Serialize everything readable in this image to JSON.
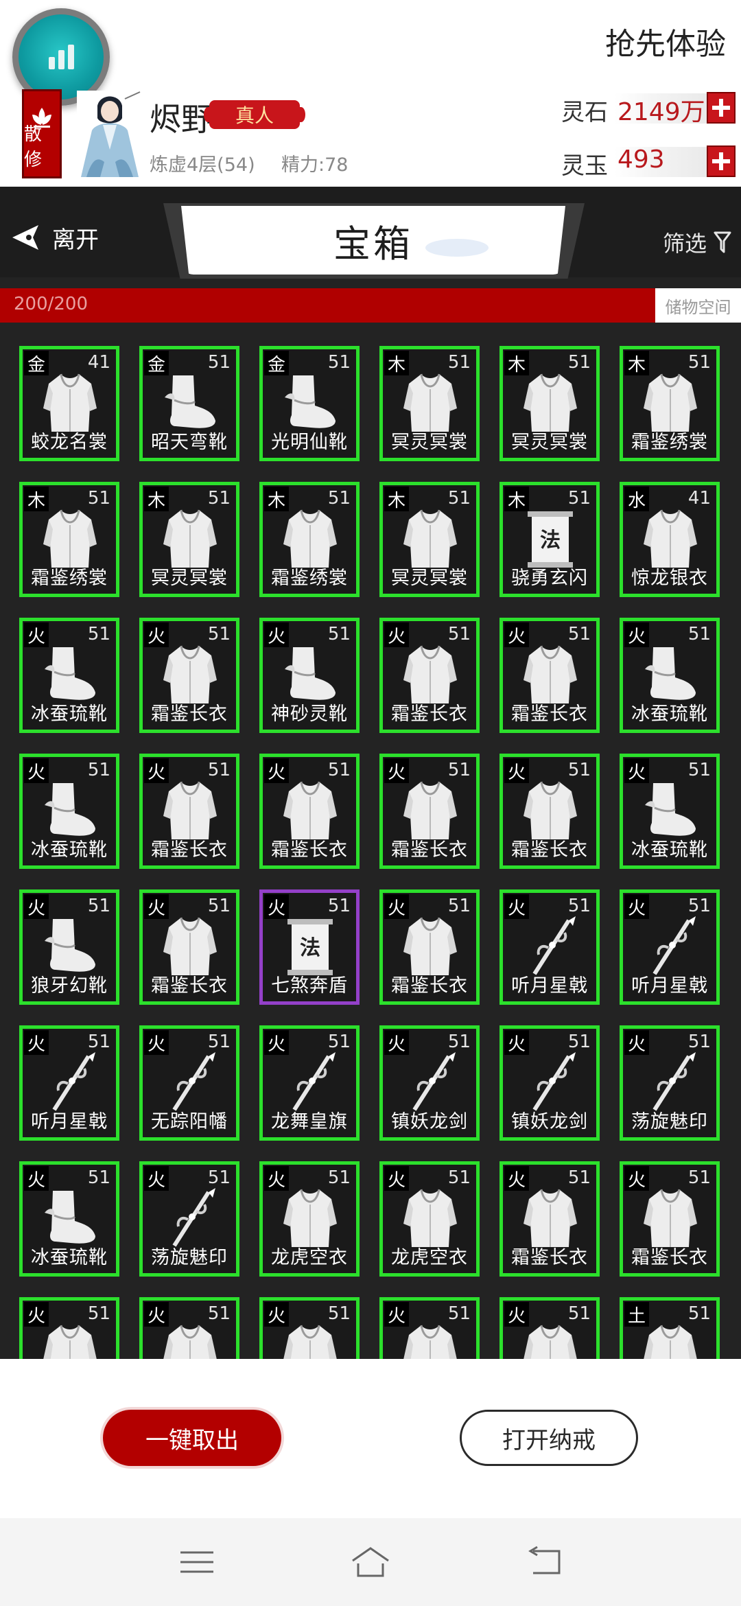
{
  "header": {
    "try_first": "抢先体验",
    "sect_badge": "散修",
    "player_name": "烬野",
    "title_badge": "真人",
    "realm": "炼虚4层(54)",
    "energy": "精力:78",
    "currencies": [
      {
        "label": "灵石",
        "value": "2149万"
      },
      {
        "label": "灵玉",
        "value": "493"
      }
    ]
  },
  "nav": {
    "leave": "离开",
    "title": "宝箱",
    "filter": "筛选"
  },
  "storage": {
    "capacity": "200/200",
    "tab": "储物空间"
  },
  "items": [
    {
      "el": "金",
      "lv": "41",
      "name": "蛟龙名裳",
      "icon": "robe",
      "rarity": "green"
    },
    {
      "el": "金",
      "lv": "51",
      "name": "昭天弯靴",
      "icon": "boot",
      "rarity": "green"
    },
    {
      "el": "金",
      "lv": "51",
      "name": "光明仙靴",
      "icon": "boot",
      "rarity": "green"
    },
    {
      "el": "木",
      "lv": "51",
      "name": "冥灵冥裳",
      "icon": "robe",
      "rarity": "green"
    },
    {
      "el": "木",
      "lv": "51",
      "name": "冥灵冥裳",
      "icon": "robe",
      "rarity": "green"
    },
    {
      "el": "木",
      "lv": "51",
      "name": "霜鉴绣裳",
      "icon": "robe",
      "rarity": "green"
    },
    {
      "el": "木",
      "lv": "51",
      "name": "霜鉴绣裳",
      "icon": "robe",
      "rarity": "green"
    },
    {
      "el": "木",
      "lv": "51",
      "name": "冥灵冥裳",
      "icon": "robe",
      "rarity": "green"
    },
    {
      "el": "木",
      "lv": "51",
      "name": "霜鉴绣裳",
      "icon": "robe",
      "rarity": "green"
    },
    {
      "el": "木",
      "lv": "51",
      "name": "冥灵冥裳",
      "icon": "robe",
      "rarity": "green"
    },
    {
      "el": "木",
      "lv": "51",
      "name": "骁勇玄闪",
      "icon": "scroll",
      "glyph": "法",
      "rarity": "green"
    },
    {
      "el": "水",
      "lv": "41",
      "name": "惊龙银衣",
      "icon": "robe",
      "rarity": "green"
    },
    {
      "el": "火",
      "lv": "51",
      "name": "冰蚕琉靴",
      "icon": "boot",
      "rarity": "green"
    },
    {
      "el": "火",
      "lv": "51",
      "name": "霜鉴长衣",
      "icon": "robe",
      "rarity": "green"
    },
    {
      "el": "火",
      "lv": "51",
      "name": "神砂灵靴",
      "icon": "boot",
      "rarity": "green"
    },
    {
      "el": "火",
      "lv": "51",
      "name": "霜鉴长衣",
      "icon": "robe",
      "rarity": "green"
    },
    {
      "el": "火",
      "lv": "51",
      "name": "霜鉴长衣",
      "icon": "robe",
      "rarity": "green"
    },
    {
      "el": "火",
      "lv": "51",
      "name": "冰蚕琉靴",
      "icon": "boot",
      "rarity": "green"
    },
    {
      "el": "火",
      "lv": "51",
      "name": "冰蚕琉靴",
      "icon": "boot",
      "rarity": "green"
    },
    {
      "el": "火",
      "lv": "51",
      "name": "霜鉴长衣",
      "icon": "robe",
      "rarity": "green"
    },
    {
      "el": "火",
      "lv": "51",
      "name": "霜鉴长衣",
      "icon": "robe",
      "rarity": "green"
    },
    {
      "el": "火",
      "lv": "51",
      "name": "霜鉴长衣",
      "icon": "robe",
      "rarity": "green"
    },
    {
      "el": "火",
      "lv": "51",
      "name": "霜鉴长衣",
      "icon": "robe",
      "rarity": "green"
    },
    {
      "el": "火",
      "lv": "51",
      "name": "冰蚕琉靴",
      "icon": "boot",
      "rarity": "green"
    },
    {
      "el": "火",
      "lv": "51",
      "name": "狼牙幻靴",
      "icon": "boot",
      "rarity": "green"
    },
    {
      "el": "火",
      "lv": "51",
      "name": "霜鉴长衣",
      "icon": "robe",
      "rarity": "green"
    },
    {
      "el": "火",
      "lv": "51",
      "name": "七煞奔盾",
      "icon": "scroll",
      "glyph": "法",
      "rarity": "purple"
    },
    {
      "el": "火",
      "lv": "51",
      "name": "霜鉴长衣",
      "icon": "robe",
      "rarity": "green"
    },
    {
      "el": "火",
      "lv": "51",
      "name": "听月星戟",
      "icon": "weapon",
      "rarity": "green"
    },
    {
      "el": "火",
      "lv": "51",
      "name": "听月星戟",
      "icon": "weapon",
      "rarity": "green"
    },
    {
      "el": "火",
      "lv": "51",
      "name": "听月星戟",
      "icon": "weapon",
      "rarity": "green"
    },
    {
      "el": "火",
      "lv": "51",
      "name": "无踪阳幡",
      "icon": "weapon",
      "rarity": "green"
    },
    {
      "el": "火",
      "lv": "51",
      "name": "龙舞皇旗",
      "icon": "weapon",
      "rarity": "green"
    },
    {
      "el": "火",
      "lv": "51",
      "name": "镇妖龙剑",
      "icon": "weapon",
      "rarity": "green"
    },
    {
      "el": "火",
      "lv": "51",
      "name": "镇妖龙剑",
      "icon": "weapon",
      "rarity": "green"
    },
    {
      "el": "火",
      "lv": "51",
      "name": "荡旋魅印",
      "icon": "weapon",
      "rarity": "green"
    },
    {
      "el": "火",
      "lv": "51",
      "name": "冰蚕琉靴",
      "icon": "boot",
      "rarity": "green"
    },
    {
      "el": "火",
      "lv": "51",
      "name": "荡旋魅印",
      "icon": "weapon",
      "rarity": "green"
    },
    {
      "el": "火",
      "lv": "51",
      "name": "龙虎空衣",
      "icon": "robe",
      "rarity": "green"
    },
    {
      "el": "火",
      "lv": "51",
      "name": "龙虎空衣",
      "icon": "robe",
      "rarity": "green"
    },
    {
      "el": "火",
      "lv": "51",
      "name": "霜鉴长衣",
      "icon": "robe",
      "rarity": "green"
    },
    {
      "el": "火",
      "lv": "51",
      "name": "霜鉴长衣",
      "icon": "robe",
      "rarity": "green"
    },
    {
      "el": "火",
      "lv": "51",
      "name": "",
      "icon": "robe",
      "rarity": "green"
    },
    {
      "el": "火",
      "lv": "51",
      "name": "",
      "icon": "robe",
      "rarity": "green"
    },
    {
      "el": "火",
      "lv": "51",
      "name": "",
      "icon": "robe",
      "rarity": "green"
    },
    {
      "el": "火",
      "lv": "51",
      "name": "",
      "icon": "robe",
      "rarity": "green"
    },
    {
      "el": "火",
      "lv": "51",
      "name": "",
      "icon": "robe",
      "rarity": "green"
    },
    {
      "el": "土",
      "lv": "51",
      "name": "",
      "icon": "robe",
      "rarity": "green"
    }
  ],
  "actions": {
    "take_all": "一键取出",
    "open_ring": "打开纳戒"
  },
  "colors": {
    "accent_red": "#b30000",
    "item_border_green": "#2ce02c",
    "item_border_purple": "#9440c9",
    "currency_value": "#b8191d"
  },
  "system_nav": [
    "menu-icon",
    "home-icon",
    "back-icon"
  ]
}
